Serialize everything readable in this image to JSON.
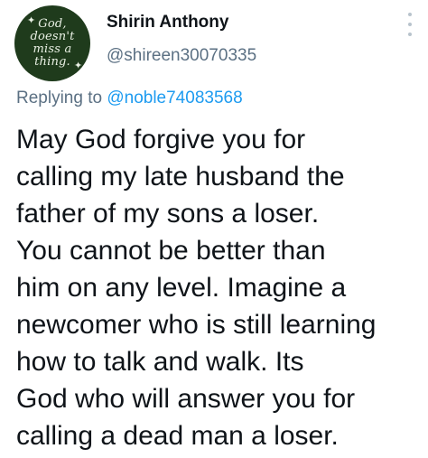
{
  "author": {
    "name": "Shirin Anthony",
    "handle": "@shireen30070335",
    "avatar": {
      "lines": [
        "God,",
        "doesn't",
        "miss a",
        "thing."
      ],
      "background": "#1f3b1c",
      "text_color": "#e9f0e4"
    }
  },
  "reply": {
    "prefix": "Replying to",
    "to": "@noble74083568"
  },
  "tweet": {
    "lines": [
      "May God forgive you for",
      "calling my late husband the",
      "father of my sons a loser.",
      "You cannot be better than",
      "him on any level. Imagine a",
      "newcomer who is still learning",
      "how to talk and walk. Its",
      "God who will answer you for",
      "calling a dead man a loser."
    ]
  },
  "icons": {
    "more": "more-vertical-icon"
  },
  "colors": {
    "text": "#0f1419",
    "secondary": "#5b7083",
    "link": "#1d9bf0"
  }
}
